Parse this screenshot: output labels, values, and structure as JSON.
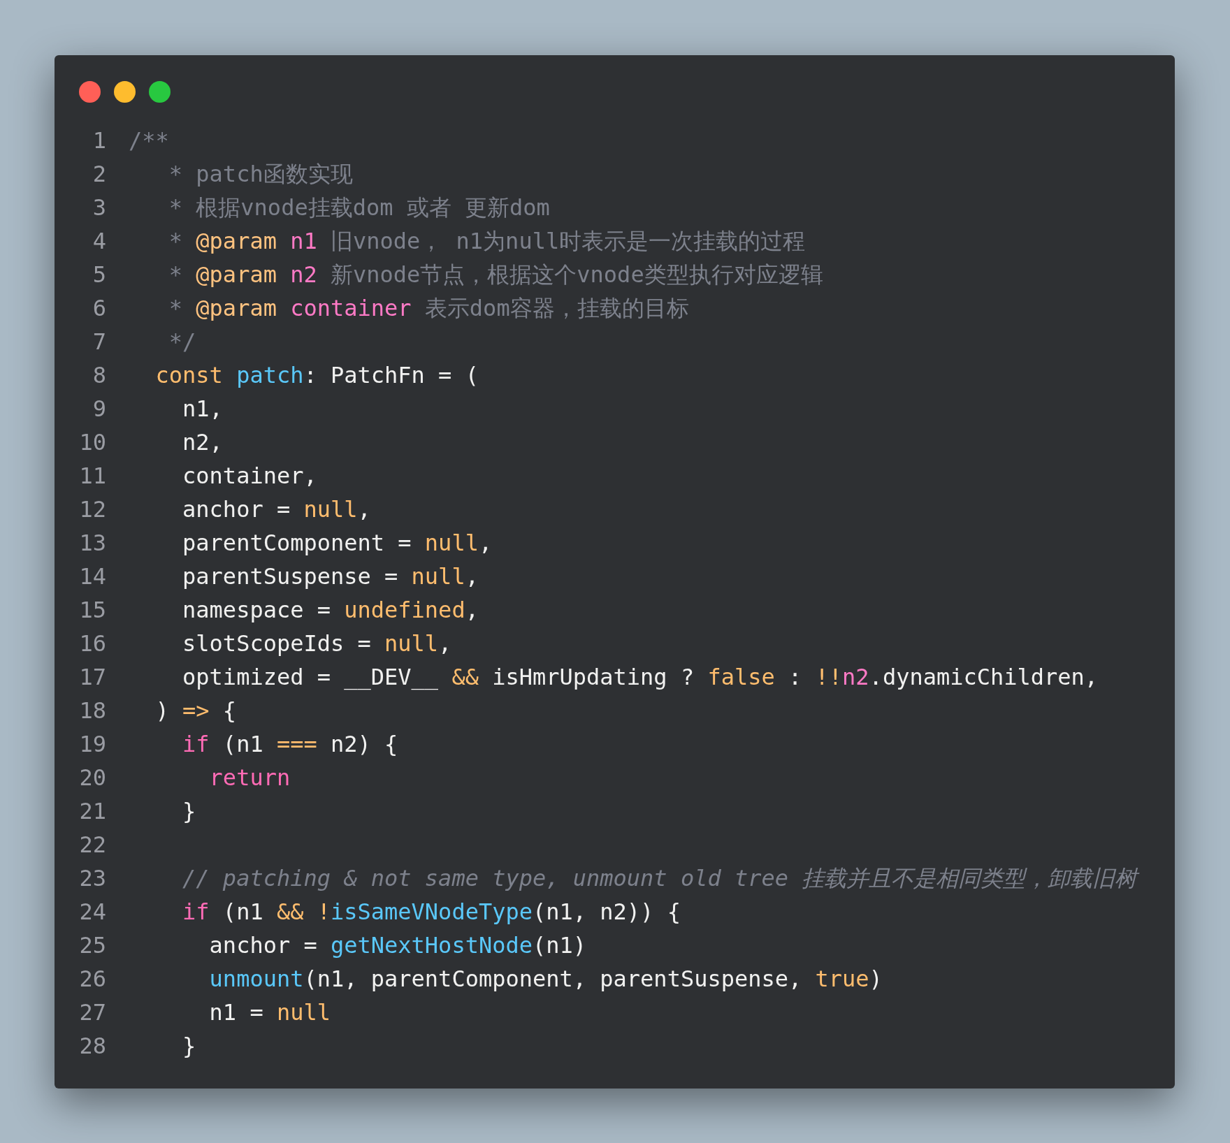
{
  "code_lines": [
    {
      "number": "1",
      "tokens": [
        {
          "kind": "comment",
          "text": "/**"
        }
      ]
    },
    {
      "number": "2",
      "tokens": [
        {
          "kind": "comment",
          "text": "   * patch函数实现"
        }
      ]
    },
    {
      "number": "3",
      "tokens": [
        {
          "kind": "comment",
          "text": "   * 根据vnode挂载dom 或者 更新dom"
        }
      ]
    },
    {
      "number": "4",
      "tokens": [
        {
          "kind": "comment",
          "text": "   * "
        },
        {
          "kind": "tag",
          "text": "@param"
        },
        {
          "kind": "param",
          "text": " n1"
        },
        {
          "kind": "comment",
          "text": " 旧vnode， n1为null时表示是一次挂载的过程"
        }
      ]
    },
    {
      "number": "5",
      "tokens": [
        {
          "kind": "comment",
          "text": "   * "
        },
        {
          "kind": "tag",
          "text": "@param"
        },
        {
          "kind": "param",
          "text": " n2"
        },
        {
          "kind": "comment",
          "text": " 新vnode节点，根据这个vnode类型执行对应逻辑"
        }
      ]
    },
    {
      "number": "6",
      "tokens": [
        {
          "kind": "comment",
          "text": "   * "
        },
        {
          "kind": "tag",
          "text": "@param"
        },
        {
          "kind": "param",
          "text": " container"
        },
        {
          "kind": "comment",
          "text": " 表示dom容器，挂载的目标"
        }
      ]
    },
    {
      "number": "7",
      "tokens": [
        {
          "kind": "comment",
          "text": "   */"
        }
      ]
    },
    {
      "number": "8",
      "tokens": [
        {
          "kind": "literal",
          "text": "  const"
        },
        {
          "kind": "function",
          "text": " patch"
        },
        {
          "kind": "plain",
          "text": ": PatchFn = ("
        }
      ]
    },
    {
      "number": "9",
      "tokens": [
        {
          "kind": "plain",
          "text": "    n1,"
        }
      ]
    },
    {
      "number": "10",
      "tokens": [
        {
          "kind": "plain",
          "text": "    n2,"
        }
      ]
    },
    {
      "number": "11",
      "tokens": [
        {
          "kind": "plain",
          "text": "    container,"
        }
      ]
    },
    {
      "number": "12",
      "tokens": [
        {
          "kind": "plain",
          "text": "    anchor = "
        },
        {
          "kind": "literal",
          "text": "null"
        },
        {
          "kind": "plain",
          "text": ","
        }
      ]
    },
    {
      "number": "13",
      "tokens": [
        {
          "kind": "plain",
          "text": "    parentComponent = "
        },
        {
          "kind": "literal",
          "text": "null"
        },
        {
          "kind": "plain",
          "text": ","
        }
      ]
    },
    {
      "number": "14",
      "tokens": [
        {
          "kind": "plain",
          "text": "    parentSuspense = "
        },
        {
          "kind": "literal",
          "text": "null"
        },
        {
          "kind": "plain",
          "text": ","
        }
      ]
    },
    {
      "number": "15",
      "tokens": [
        {
          "kind": "plain",
          "text": "    namespace = "
        },
        {
          "kind": "literal",
          "text": "undefined"
        },
        {
          "kind": "plain",
          "text": ","
        }
      ]
    },
    {
      "number": "16",
      "tokens": [
        {
          "kind": "plain",
          "text": "    slotScopeIds = "
        },
        {
          "kind": "literal",
          "text": "null"
        },
        {
          "kind": "plain",
          "text": ","
        }
      ]
    },
    {
      "number": "17",
      "tokens": [
        {
          "kind": "plain",
          "text": "    optimized = __DEV__ "
        },
        {
          "kind": "literal",
          "text": "&&"
        },
        {
          "kind": "plain",
          "text": " isHmrUpdating ? "
        },
        {
          "kind": "literal",
          "text": "false"
        },
        {
          "kind": "plain",
          "text": " : "
        },
        {
          "kind": "literal",
          "text": "!!"
        },
        {
          "kind": "param",
          "text": "n2"
        },
        {
          "kind": "plain",
          "text": ".dynamicChildren,"
        }
      ]
    },
    {
      "number": "18",
      "tokens": [
        {
          "kind": "plain",
          "text": "  ) "
        },
        {
          "kind": "literal",
          "text": "=>"
        },
        {
          "kind": "plain",
          "text": " {"
        }
      ]
    },
    {
      "number": "19",
      "tokens": [
        {
          "kind": "keyword",
          "text": "    if"
        },
        {
          "kind": "plain",
          "text": " (n1 "
        },
        {
          "kind": "literal",
          "text": "==="
        },
        {
          "kind": "plain",
          "text": " n2) {"
        }
      ]
    },
    {
      "number": "20",
      "tokens": [
        {
          "kind": "keyword",
          "text": "      return"
        }
      ]
    },
    {
      "number": "21",
      "tokens": [
        {
          "kind": "plain",
          "text": "    }"
        }
      ]
    },
    {
      "number": "22"
    },
    {
      "number": "23",
      "tokens": [
        {
          "kind": "line_comment",
          "text": "    // patching & not same type, unmount old tree 挂载并且不是相同类型，卸载旧树"
        }
      ]
    },
    {
      "number": "24",
      "tokens": [
        {
          "kind": "keyword",
          "text": "    if"
        },
        {
          "kind": "plain",
          "text": " (n1 "
        },
        {
          "kind": "literal",
          "text": "&& !"
        },
        {
          "kind": "function",
          "text": "isSameVNodeType"
        },
        {
          "kind": "plain",
          "text": "(n1, n2)) {"
        }
      ]
    },
    {
      "number": "25",
      "tokens": [
        {
          "kind": "plain",
          "text": "      anchor = "
        },
        {
          "kind": "function",
          "text": "getNextHostNode"
        },
        {
          "kind": "plain",
          "text": "(n1)"
        }
      ]
    },
    {
      "number": "26",
      "tokens": [
        {
          "kind": "function",
          "text": "      unmount"
        },
        {
          "kind": "plain",
          "text": "(n1, parentComponent, parentSuspense, "
        },
        {
          "kind": "literal",
          "text": "true"
        },
        {
          "kind": "plain",
          "text": ")"
        }
      ]
    },
    {
      "number": "27",
      "tokens": [
        {
          "kind": "plain",
          "text": "      n1 = "
        },
        {
          "kind": "literal",
          "text": "null"
        }
      ]
    },
    {
      "number": "28",
      "tokens": [
        {
          "kind": "plain",
          "text": "    }"
        }
      ]
    }
  ]
}
